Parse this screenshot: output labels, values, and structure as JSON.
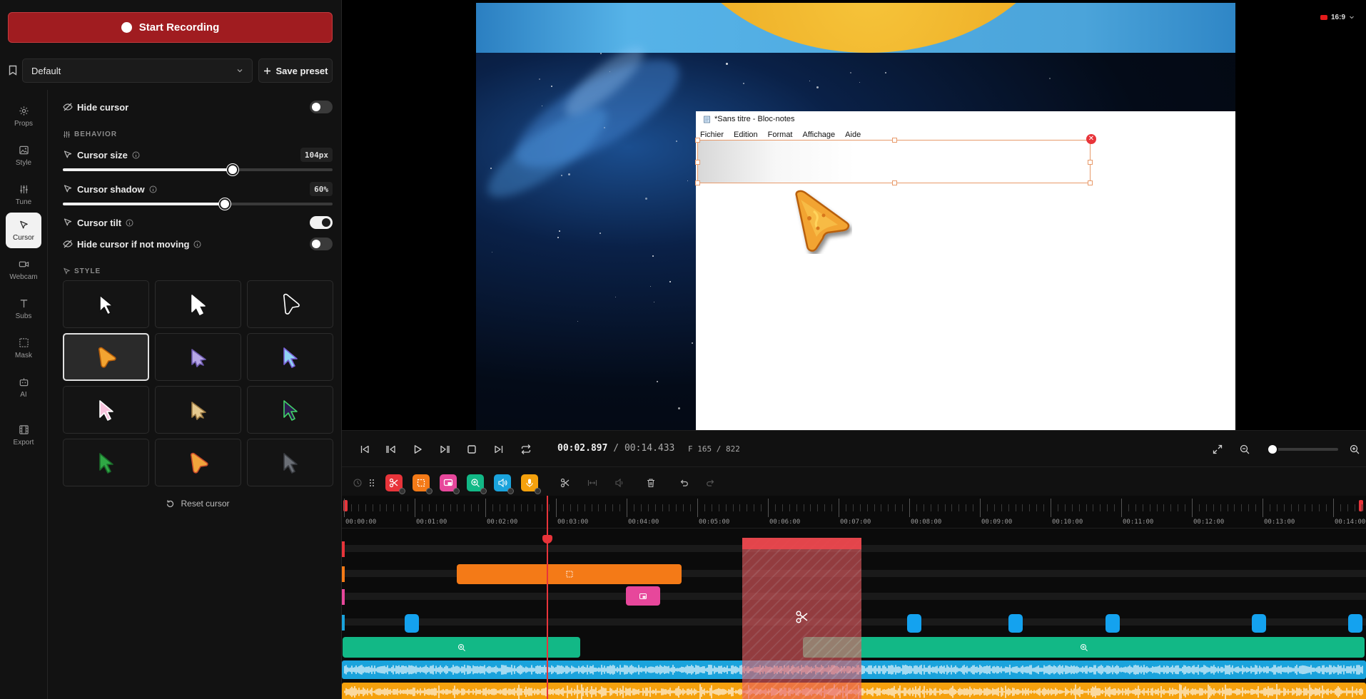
{
  "recording": {
    "start_label": "Start Recording"
  },
  "preset": {
    "selected": "Default",
    "save_label": "Save preset"
  },
  "nav": [
    {
      "label": "Props",
      "icon": "gear-icon"
    },
    {
      "label": "Style",
      "icon": "image-icon"
    },
    {
      "label": "Tune",
      "icon": "sliders-icon"
    },
    {
      "label": "Cursor",
      "icon": "cursor-icon",
      "active": true
    },
    {
      "label": "Webcam",
      "icon": "camera-icon"
    },
    {
      "label": "Subs",
      "icon": "text-icon"
    },
    {
      "label": "Mask",
      "icon": "mask-icon"
    },
    {
      "label": "AI",
      "icon": "robot-icon"
    },
    {
      "label": "Export",
      "icon": "film-icon"
    }
  ],
  "cursor_settings": {
    "hide_cursor": {
      "label": "Hide cursor",
      "on": false
    },
    "behavior_heading": "BEHAVIOR",
    "cursor_size": {
      "label": "Cursor size",
      "value_text": "104px",
      "fraction": 0.63
    },
    "cursor_shadow": {
      "label": "Cursor shadow",
      "value_text": "60%",
      "fraction": 0.6
    },
    "cursor_tilt": {
      "label": "Cursor tilt",
      "on": true
    },
    "hide_if_not_moving": {
      "label": "Hide cursor if not moving",
      "on": false
    },
    "style_heading": "STYLE",
    "reset_label": "Reset cursor"
  },
  "cursor_styles": [
    {
      "name": "outline-white-arrow",
      "fill": "#ffffff",
      "stroke": "#111111"
    },
    {
      "name": "solid-white-arrow",
      "fill": "#ffffff",
      "stroke": "#ffffff"
    },
    {
      "name": "rounded-outline-arrow",
      "fill": "none",
      "stroke": "#ffffff"
    },
    {
      "name": "nacho-cheese-cursor",
      "fill": "#f2a431",
      "stroke": "#b85f0a",
      "selected": true
    },
    {
      "name": "lavender-tree-cursor",
      "fill": "#b6a6e6",
      "stroke": "#6f5bb0"
    },
    {
      "name": "holographic-arrow",
      "fill": "#8fd4f2",
      "stroke": "#7a62d8"
    },
    {
      "name": "pink-arrow",
      "fill": "#f7c3dd",
      "stroke": "#ffffff"
    },
    {
      "name": "shell-cursor",
      "fill": "#e5c98f",
      "stroke": "#9c7a43"
    },
    {
      "name": "galaxy-green-arrow",
      "fill": "#2c1b4f",
      "stroke": "#42d26a"
    },
    {
      "name": "green-tree-arrow",
      "fill": "#2fa845",
      "stroke": "#1a6b2a"
    },
    {
      "name": "pizza-cursor",
      "fill": "#f0a43c",
      "stroke": "#c84a2a"
    },
    {
      "name": "gray-arrow",
      "fill": "#6b6f76",
      "stroke": "#3a3d42"
    }
  ],
  "preview": {
    "aspect_label": "16:9",
    "notepad": {
      "title": "*Sans titre - Bloc-notes",
      "menu": [
        "Fichier",
        "Edition",
        "Format",
        "Affichage",
        "Aide"
      ]
    }
  },
  "transport": {
    "current_time": "00:02.897",
    "separator": " / ",
    "total_time": "00:14.433",
    "frame_text": "F 165 / 822",
    "zoom_fraction": 0.08
  },
  "timeline": {
    "ticks": [
      "00:00:00",
      "00:01:00",
      "00:02:00",
      "00:03:00",
      "00:04:00",
      "00:05:00",
      "00:06:00",
      "00:07:00",
      "00:08:00",
      "00:09:00",
      "00:10:00",
      "00:11:00",
      "00:12:00",
      "00:13:00",
      "00:14:00"
    ],
    "colors": {
      "cut": "#e8343a",
      "crop": "#f47a17",
      "layout": "#e7479b",
      "zoom": "#12b886",
      "audio": "#1aa3dc",
      "mic": "#f5a10d"
    }
  }
}
